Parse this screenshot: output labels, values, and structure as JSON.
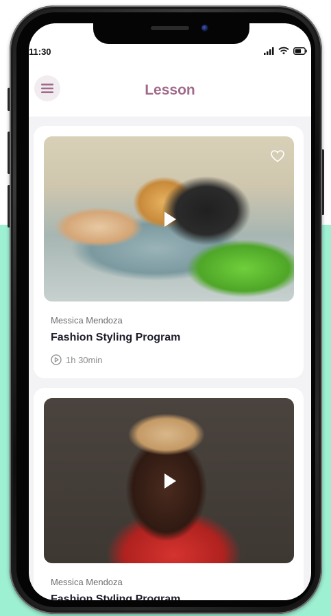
{
  "status_bar": {
    "time": "11:30"
  },
  "header": {
    "title": "Lesson",
    "menu_icon": "hamburger-menu-icon"
  },
  "lessons": [
    {
      "author": "Messica Mendoza",
      "title": "Fashion Styling Program",
      "duration": "1h 30min",
      "favorite_icon": "heart-icon"
    },
    {
      "author": "Messica Mendoza",
      "title": "Fashion Styling Program"
    }
  ],
  "colors": {
    "accent": "#a06b8a",
    "mint_background": "#9ef0d3"
  }
}
